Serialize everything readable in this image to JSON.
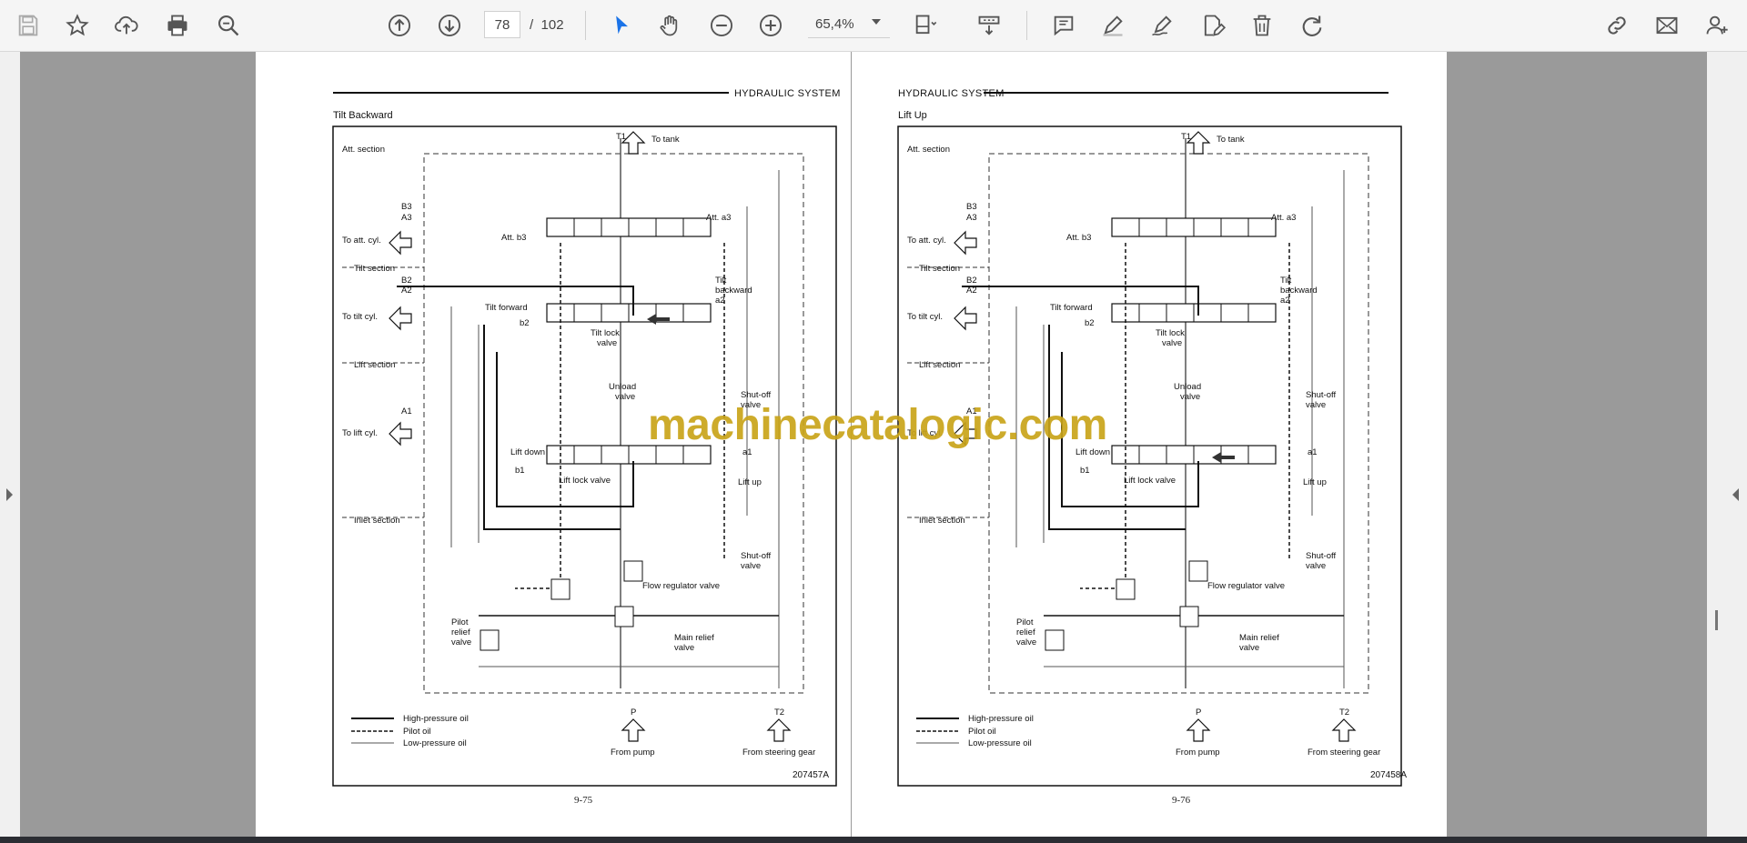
{
  "toolbar": {
    "left_icons": [
      "save-icon",
      "star-icon",
      "upload-icon",
      "print-icon",
      "zoom-search-icon"
    ],
    "nav": {
      "current_page": "78",
      "separator": "/",
      "total_pages": "102"
    },
    "zoom": "65,4%",
    "right_icons": [
      "comment-icon",
      "pen-icon",
      "sign-icon",
      "edit-icon",
      "trash-icon",
      "redo-icon",
      "link-icon",
      "mail-icon",
      "add-user-icon"
    ]
  },
  "pages": [
    {
      "header": "HYDRAULIC SYSTEM",
      "title": "Tilt Backward",
      "page_number": "9-75",
      "figure_id": "207457A",
      "labels": {
        "t1": "T1",
        "to_tank": "To tank",
        "att_section": "Att. section",
        "b3": "B3",
        "a3": "A3",
        "att_b3": "Att. b3",
        "att_a3": "Att. a3",
        "to_att_cyl": "To att. cyl.",
        "tilt_section": "Tilt section",
        "b2": "B2",
        "a2": "A2",
        "tilt_forward": "Tilt forward",
        "b2_port": "b2",
        "tilt_backward": "Tilt",
        "tilt_backward2": "backward",
        "tilt_a2": "a2",
        "tilt_lock": "Tilt lock",
        "valve1": "valve",
        "to_tilt_cyl": "To tilt cyl.",
        "lift_section": "Lift section",
        "unload": "Unload",
        "valve2": "valve",
        "shutoff": "Shut-off",
        "valve3": "valve",
        "a1": "A1",
        "to_lift_cyl": "To lift cyl.",
        "lift_down": "Lift down",
        "b1": "b1",
        "a1_port": "a1",
        "lift_lock": "Lift lock valve",
        "lift_up": "Lift up",
        "inlet_section": "Inlet section",
        "shutoff2": "Shut-off",
        "valve4": "valve",
        "flow_reg": "Flow regulator valve",
        "pilot": "Pilot",
        "relief": "relief",
        "valve5": "valve",
        "main_relief": "Main relief",
        "valve6": "valve",
        "legend_hp": "High-pressure oil",
        "legend_pilot": "Pilot oil",
        "legend_lp": "Low-pressure oil",
        "p": "P",
        "t2": "T2",
        "from_pump": "From pump",
        "from_steering": "From steering gear"
      }
    },
    {
      "header": "HYDRAULIC SYSTEM",
      "title": "Lift Up",
      "page_number": "9-76",
      "figure_id": "207458A",
      "labels": {
        "t1": "T1",
        "to_tank": "To tank",
        "att_section": "Att. section",
        "b3": "B3",
        "a3": "A3",
        "att_b3": "Att. b3",
        "att_a3": "Att. a3",
        "to_att_cyl": "To att. cyl.",
        "tilt_section": "Tilt section",
        "b2": "B2",
        "a2": "A2",
        "tilt_forward": "Tilt forward",
        "b2_port": "b2",
        "tilt_backward": "Tilt",
        "tilt_backward2": "backward",
        "tilt_a2": "a2",
        "tilt_lock": "Tilt lock",
        "valve1": "valve",
        "to_tilt_cyl": "To tilt cyl.",
        "lift_section": "Lift section",
        "unload": "Unload",
        "valve2": "valve",
        "shutoff": "Shut-off",
        "valve3": "valve",
        "a1": "A1",
        "to_lift_cyl": "To lift cyl.",
        "lift_down": "Lift down",
        "b1": "b1",
        "a1_port": "a1",
        "lift_lock": "Lift lock valve",
        "lift_up": "Lift up",
        "inlet_section": "Inlet section",
        "shutoff2": "Shut-off",
        "valve4": "valve",
        "flow_reg": "Flow regulator valve",
        "pilot": "Pilot",
        "relief": "relief",
        "valve5": "valve",
        "main_relief": "Main relief",
        "valve6": "valve",
        "legend_hp": "High-pressure oil",
        "legend_pilot": "Pilot oil",
        "legend_lp": "Low-pressure oil",
        "p": "P",
        "t2": "T2",
        "from_pump": "From pump",
        "from_steering": "From steering gear"
      }
    }
  ],
  "watermark": "machinecatalogic.com",
  "colors": {
    "accent": "#1a73e8",
    "watermark": "#c9a41a"
  }
}
